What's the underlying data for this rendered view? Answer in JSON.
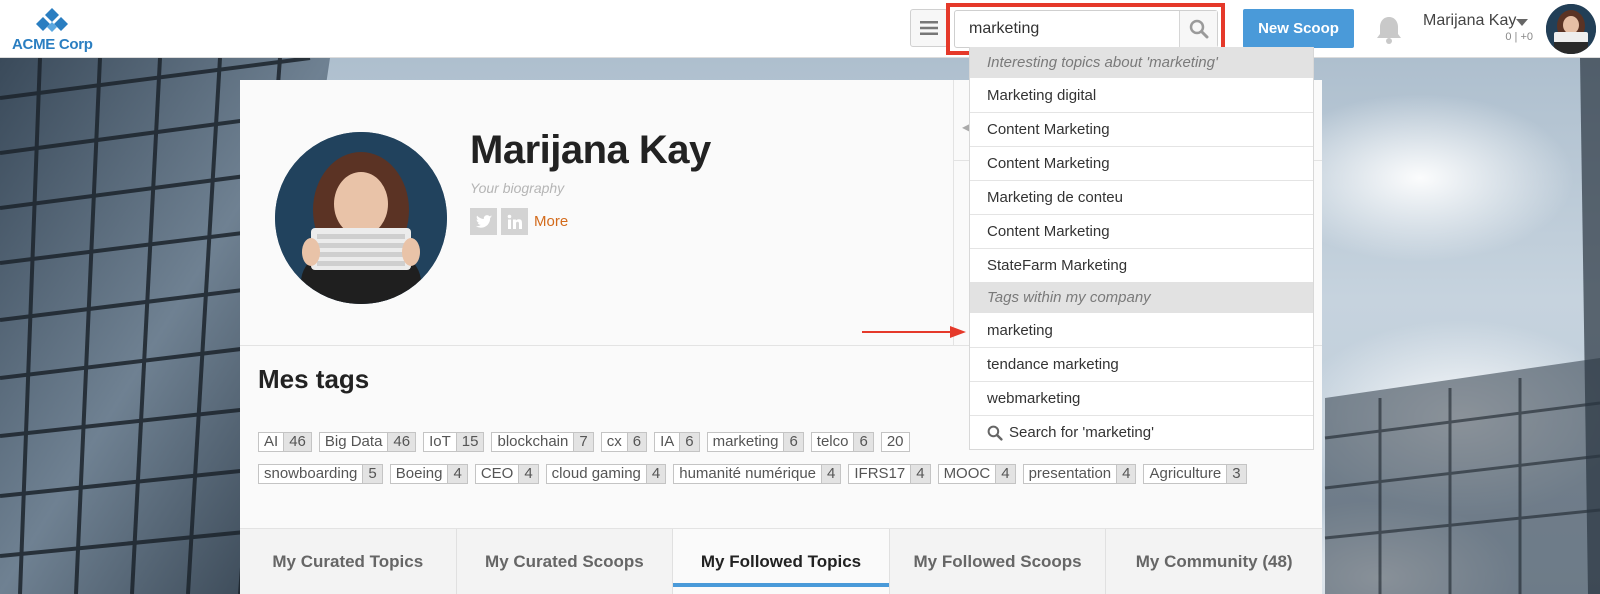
{
  "header": {
    "logo_text": "ACME Corp",
    "search": {
      "value": "marketing"
    },
    "new_scoop_label": "New Scoop",
    "user_name": "Marijana Kay",
    "user_count": "0 | +0"
  },
  "profile": {
    "name": "Marijana Kay",
    "bio_placeholder": "Your biography",
    "more_label": "More"
  },
  "tags": {
    "title": "Mes tags",
    "items": [
      {
        "name": "AI",
        "count": "46"
      },
      {
        "name": "Big Data",
        "count": "46"
      },
      {
        "name": "IoT",
        "count": "15"
      },
      {
        "name": "blockchain",
        "count": "7"
      },
      {
        "name": "cx",
        "count": "6"
      },
      {
        "name": "IA",
        "count": "6"
      },
      {
        "name": "marketing",
        "count": "6"
      },
      {
        "name": "telco",
        "count": "6"
      },
      {
        "name": "20",
        "count": ""
      },
      {
        "name": "snowboarding",
        "count": "5"
      },
      {
        "name": "Boeing",
        "count": "4"
      },
      {
        "name": "CEO",
        "count": "4"
      },
      {
        "name": "cloud gaming",
        "count": "4"
      },
      {
        "name": "humanité numérique",
        "count": "4"
      },
      {
        "name": "IFRS17",
        "count": "4"
      },
      {
        "name": "MOOC",
        "count": "4"
      },
      {
        "name": "presentation",
        "count": "4"
      },
      {
        "name": "Agriculture",
        "count": "3"
      }
    ]
  },
  "tabs": [
    {
      "label": "My Curated Topics",
      "active": false
    },
    {
      "label": "My Curated Scoops",
      "active": false
    },
    {
      "label": "My Followed Topics",
      "active": true
    },
    {
      "label": "My Followed Scoops",
      "active": false
    },
    {
      "label": "My Community (48)",
      "active": false
    }
  ],
  "dropdown": {
    "topics_header": "Interesting topics about 'marketing'",
    "topics": [
      "Marketing digital",
      "Content Marketing",
      "Content Marketing",
      "Marketing de conteu",
      "Content Marketing",
      "StateFarm Marketing"
    ],
    "tags_header": "Tags within my company",
    "tags": [
      "marketing",
      "tendance marketing",
      "webmarketing"
    ],
    "search_label": "Search for 'marketing'"
  },
  "colors": {
    "brand_blue": "#2a7ec1",
    "button_blue": "#4a9ad9",
    "highlight_red": "#e5392a",
    "more_orange": "#d36b1c"
  }
}
